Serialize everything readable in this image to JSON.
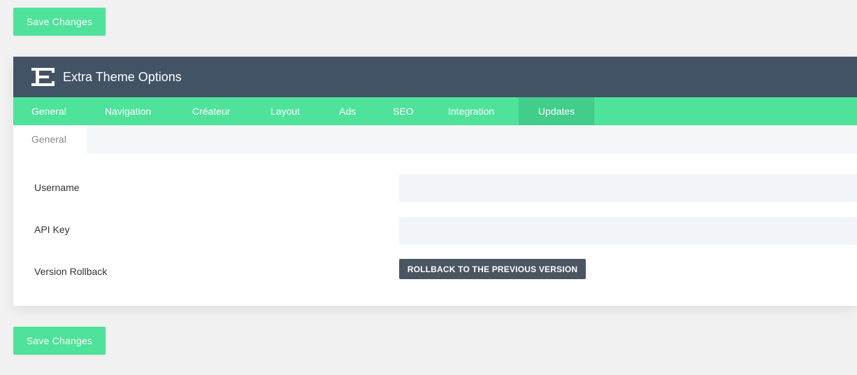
{
  "save_button": {
    "label": "Save Changes"
  },
  "panel": {
    "title": "Extra Theme Options",
    "logo_icon": "extra-logo-icon"
  },
  "tabs": [
    {
      "label": "General",
      "active": false
    },
    {
      "label": "Navigation",
      "active": false
    },
    {
      "label": "Créateur",
      "active": false
    },
    {
      "label": "Layout",
      "active": false
    },
    {
      "label": "Ads",
      "active": false
    },
    {
      "label": "SEO",
      "active": false
    },
    {
      "label": "Integration",
      "active": false
    },
    {
      "label": "Updates",
      "active": true
    }
  ],
  "subtabs": [
    {
      "label": "General",
      "active": true
    }
  ],
  "fields": {
    "username": {
      "label": "Username",
      "value": "",
      "placeholder": ""
    },
    "api_key": {
      "label": "API Key",
      "value": "",
      "placeholder": ""
    },
    "version_rollback": {
      "label": "Version Rollback",
      "button_label": "ROLLBACK TO THE PREVIOUS VERSION"
    }
  },
  "colors": {
    "accent": "#4ee29a",
    "header": "#425366",
    "rollback_button": "#4a5662",
    "background": "#f1f1f1"
  }
}
